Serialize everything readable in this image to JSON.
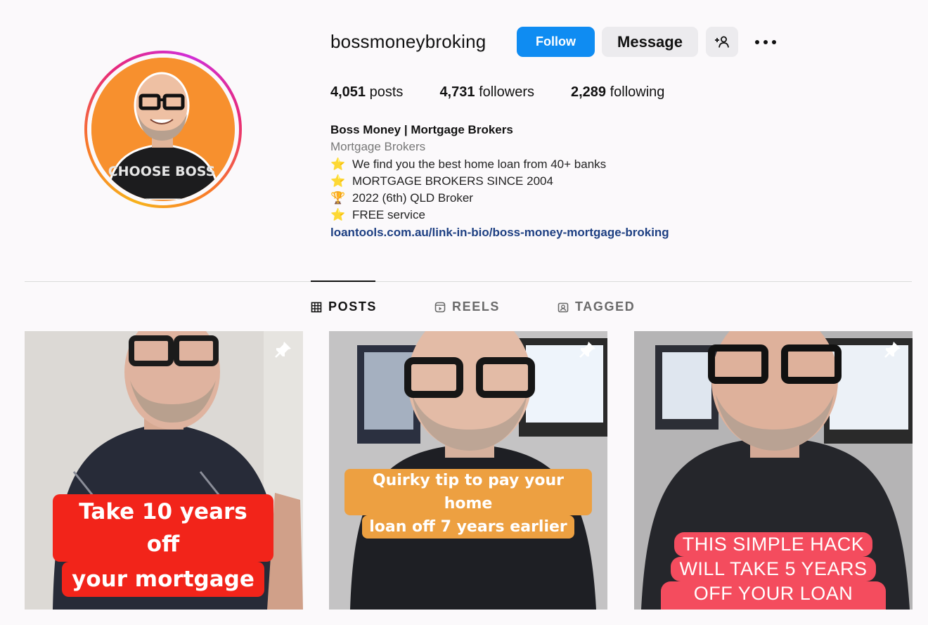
{
  "profile": {
    "username": "bossmoneybroking",
    "follow_label": "Follow",
    "message_label": "Message",
    "avatar_shirt_text": "CHOOSE BOSS"
  },
  "stats": {
    "posts_count": "4,051",
    "posts_label": "posts",
    "followers_count": "4,731",
    "followers_label": "followers",
    "following_count": "2,289",
    "following_label": "following"
  },
  "bio": {
    "name": "Boss Money | Mortgage Brokers",
    "category": "Mortgage Brokers",
    "lines": [
      {
        "emoji": "⭐",
        "text": "We find you the best home loan from 40+ banks"
      },
      {
        "emoji": "⭐",
        "text": "MORTGAGE BROKERS SINCE 2004"
      },
      {
        "emoji": "🏆",
        "text": "2022 (6th) QLD Broker"
      },
      {
        "emoji": "⭐",
        "text": "FREE service"
      }
    ],
    "link": "loantools.com.au/link-in-bio/boss-money-mortgage-broking"
  },
  "tabs": [
    {
      "label": "POSTS",
      "icon": "grid-icon",
      "active": true
    },
    {
      "label": "REELS",
      "icon": "reels-icon",
      "active": false
    },
    {
      "label": "TAGGED",
      "icon": "tagged-icon",
      "active": false
    }
  ],
  "posts": [
    {
      "caption_lines": [
        "Take 10 years off",
        "your mortgage"
      ],
      "pinned": true
    },
    {
      "caption_lines": [
        "Quirky tip to pay your home",
        "loan off 7 years earlier"
      ],
      "pinned": true
    },
    {
      "caption_lines": [
        "THIS SIMPLE HACK",
        "WILL TAKE 5 YEARS",
        "OFF YOUR LOAN TERM"
      ],
      "pinned": true
    }
  ],
  "colors": {
    "follow_button": "#0f8cf2",
    "link": "#1d3f82",
    "caption1_bg": "#f2241a",
    "caption2_bg": "#eda041",
    "caption3_bg": "#f44c5e"
  }
}
